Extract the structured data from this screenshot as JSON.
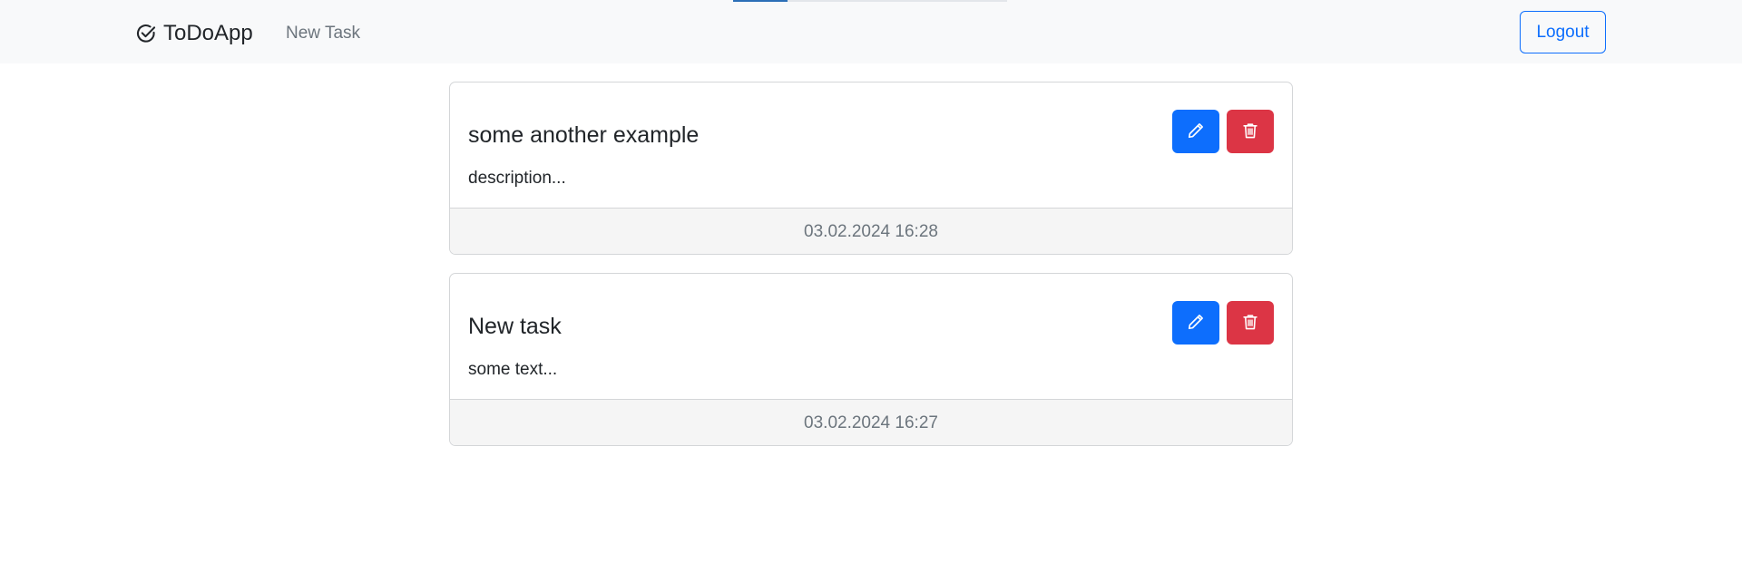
{
  "navbar": {
    "brand": {
      "label": "ToDoApp",
      "icon": "check-circle-icon"
    },
    "links": [
      {
        "label": "New Task"
      }
    ],
    "logout_label": "Logout",
    "progress": 0.2
  },
  "tasks": [
    {
      "title": "some another example",
      "description": "description...",
      "timestamp": "03.02.2024 16:28",
      "edit_icon": "pencil-icon",
      "delete_icon": "trash-icon"
    },
    {
      "title": "New task",
      "description": "some text...",
      "timestamp": "03.02.2024 16:27",
      "edit_icon": "pencil-icon",
      "delete_icon": "trash-icon"
    }
  ],
  "colors": {
    "primary": "#0d6efd",
    "danger": "#dc3545",
    "navbar_bg": "#f8f9fa",
    "muted": "#6c757d"
  }
}
